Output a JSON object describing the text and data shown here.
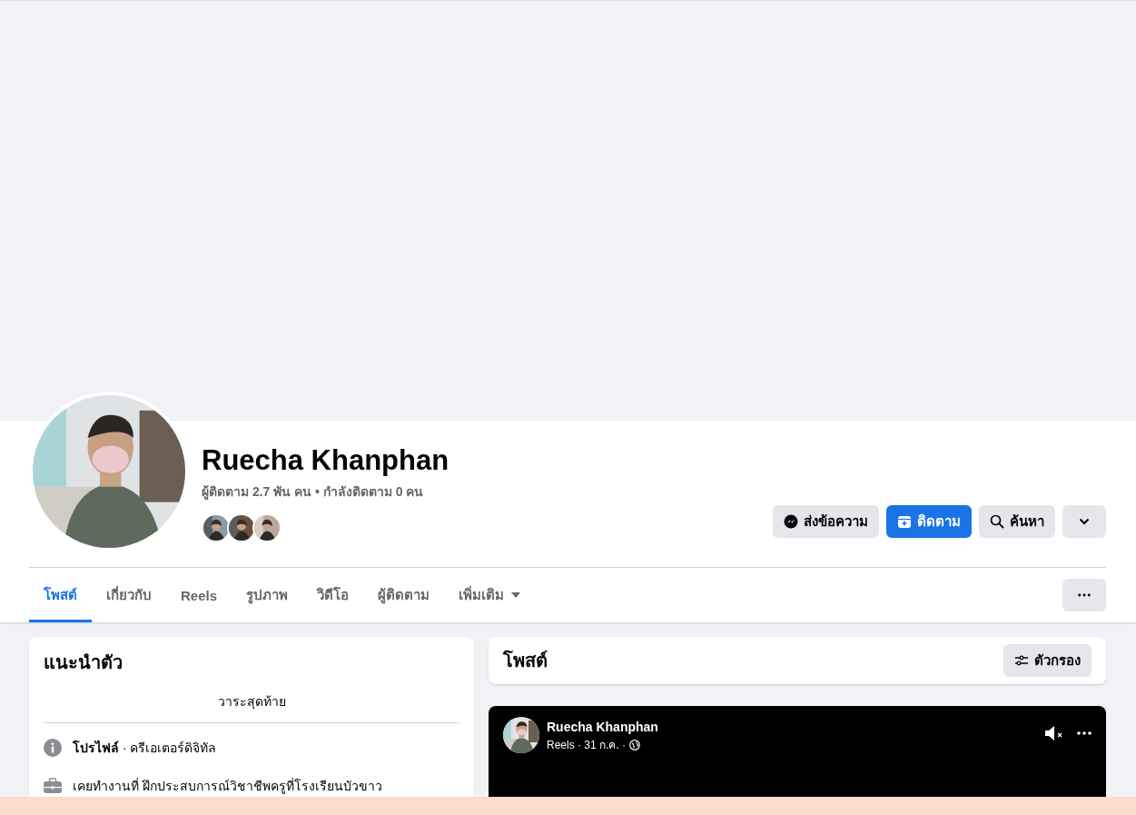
{
  "profile": {
    "name": "Ruecha Khanphan",
    "stats": "ผู้ติดตาม 2.7 พัน คน • กำลังติดตาม 0 คน"
  },
  "actions": [
    {
      "kind": "message",
      "label": "ส่งข้อความ"
    },
    {
      "kind": "follow",
      "label": "ติดตาม"
    },
    {
      "kind": "search",
      "label": "ค้นหา"
    },
    {
      "kind": "more"
    }
  ],
  "tabs": [
    {
      "label": "โพสต์",
      "selected": true
    },
    {
      "label": "เกี่ยวกับ",
      "selected": false
    },
    {
      "label": "Reels",
      "selected": false
    },
    {
      "label": "รูปภาพ",
      "selected": false
    },
    {
      "label": "วิดีโอ",
      "selected": false
    },
    {
      "label": "ผู้ติดตาม",
      "selected": false
    },
    {
      "label": "เพิ่มเติม",
      "selected": false,
      "dropdown": true
    }
  ],
  "intro": {
    "title": "แนะนำตัว",
    "subtitle": "วาระสุดท้าย",
    "items": [
      {
        "kind": "info",
        "text": "**โปรไฟล์** · ครีเอเตอร์ดิจิทัล"
      },
      {
        "kind": "work",
        "text": "เคยทำงานที่ ฝึกประสบการณ์วิชาชีพครูที่โรงเรียนบัวขาว"
      }
    ]
  },
  "posts_header": {
    "title": "โพสต์",
    "filter_label": "ตัวกรอง"
  },
  "post": {
    "author": "Ruecha Khanphan",
    "meta": "Reels · 31 ก.ค. ·",
    "muted": true
  }
}
